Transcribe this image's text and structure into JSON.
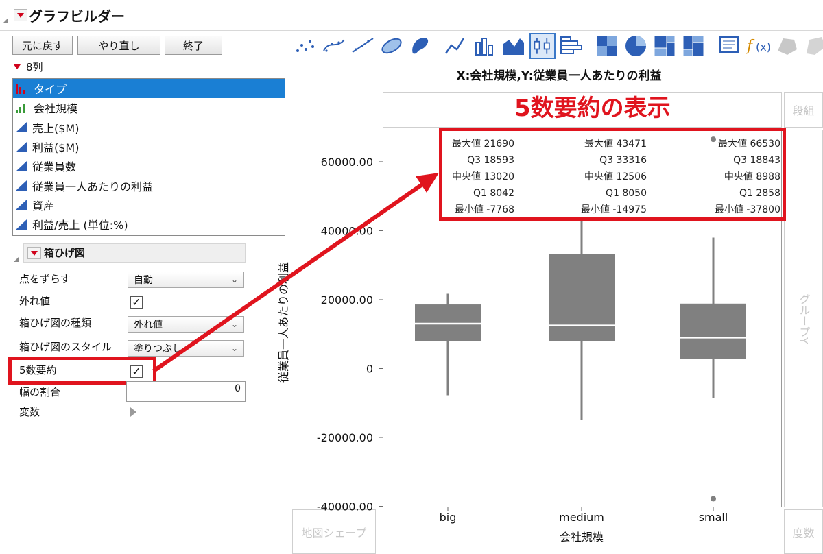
{
  "window": {
    "title": "グラフビルダー"
  },
  "buttons": {
    "undo": "元に戻す",
    "redo": "やり直し",
    "done": "終了"
  },
  "columns": {
    "count_label": "8列",
    "items": [
      {
        "label": "タイプ",
        "type": "nominal",
        "selected": true
      },
      {
        "label": "会社規模",
        "type": "ordinal",
        "selected": false
      },
      {
        "label": "売上($M)",
        "type": "continuous",
        "selected": false
      },
      {
        "label": "利益($M)",
        "type": "continuous",
        "selected": false
      },
      {
        "label": "従業員数",
        "type": "continuous",
        "selected": false
      },
      {
        "label": "従業員一人あたりの利益",
        "type": "continuous",
        "selected": false
      },
      {
        "label": "資産",
        "type": "continuous",
        "selected": false
      },
      {
        "label": "利益/売上 (単位:%)",
        "type": "continuous",
        "selected": false
      }
    ]
  },
  "boxplot_panel": {
    "title": "箱ひげ図",
    "jitter": {
      "label": "点をずらす",
      "value": "自動"
    },
    "outliers": {
      "label": "外れ値",
      "checked": true
    },
    "box_type": {
      "label": "箱ひげ図の種類",
      "value": "外れ値"
    },
    "box_style": {
      "label": "箱ひげ図のスタイル",
      "value": "塗りつぶし"
    },
    "five_number": {
      "label": "5数要約",
      "checked": true
    },
    "width_ratio": {
      "label": "幅の割合",
      "value": "0"
    },
    "variables": {
      "label": "変数"
    }
  },
  "toolbar": {
    "icons": [
      "points-icon",
      "smoother-icon",
      "line-of-fit-icon",
      "ellipse-icon",
      "contour-icon",
      "line-chart-icon",
      "bar-chart-icon",
      "area-chart-icon",
      "box-plot-icon",
      "histogram-icon",
      "heatmap-icon",
      "pie-chart-icon",
      "treemap-icon",
      "mosaic-icon",
      "caption-box-icon",
      "formula-icon",
      "map-shape-icon",
      "street-map-icon"
    ],
    "selected": "box-plot-icon"
  },
  "graph": {
    "title": "X:会社規模,Y:従業員一人あたりの利益",
    "drop_zones": {
      "wrap": "段組",
      "group_y": "グループY",
      "map_shape": "地図シェープ",
      "freq": "度数"
    },
    "annotation": "5数要約の表示"
  },
  "colors": {
    "box": "#808080",
    "median": "#ffffff",
    "highlight": "#e0141e",
    "selection": "#1a7fd4"
  },
  "chart_data": {
    "type": "box",
    "xlabel": "会社規模",
    "ylabel": "従業員一人あたりの利益",
    "ylim": [
      -40000,
      70000
    ],
    "yticks": [
      "60000.00",
      "40000.00",
      "20000.00",
      "0",
      "-20000.00",
      "-40000.00"
    ],
    "ytick_values": [
      60000,
      40000,
      20000,
      0,
      -20000,
      -40000
    ],
    "categories": [
      "big",
      "medium",
      "small"
    ],
    "series": [
      {
        "category": "big",
        "max": 21690,
        "q3": 18593,
        "median": 13020,
        "q1": 8042,
        "min": -7768,
        "outliers": []
      },
      {
        "category": "medium",
        "max": 43471,
        "q3": 33316,
        "median": 12506,
        "q1": 8050,
        "min": -14975,
        "outliers": []
      },
      {
        "category": "small",
        "max": 66530,
        "q3": 18843,
        "median": 8988,
        "q1": 2858,
        "min": -37800,
        "whisker_high": 38000,
        "whisker_low": -8500,
        "outliers": [
          66530,
          -37800
        ]
      }
    ],
    "summary_labels": {
      "max": "最大値",
      "q3": "Q3",
      "median": "中央値",
      "q1": "Q1",
      "min": "最小値"
    },
    "summary_text": [
      [
        "最大値 21690",
        "Q3  18593",
        "中央値 13020",
        "Q1  8042",
        "最小値 -7768"
      ],
      [
        "最大値 43471",
        "Q3  33316",
        "中央値 12506",
        "Q1  8050",
        "最小値 -14975"
      ],
      [
        "最大値 66530",
        "Q3  18843",
        "中央値 8988",
        "Q1  2858",
        "最小値 -37800"
      ]
    ]
  }
}
